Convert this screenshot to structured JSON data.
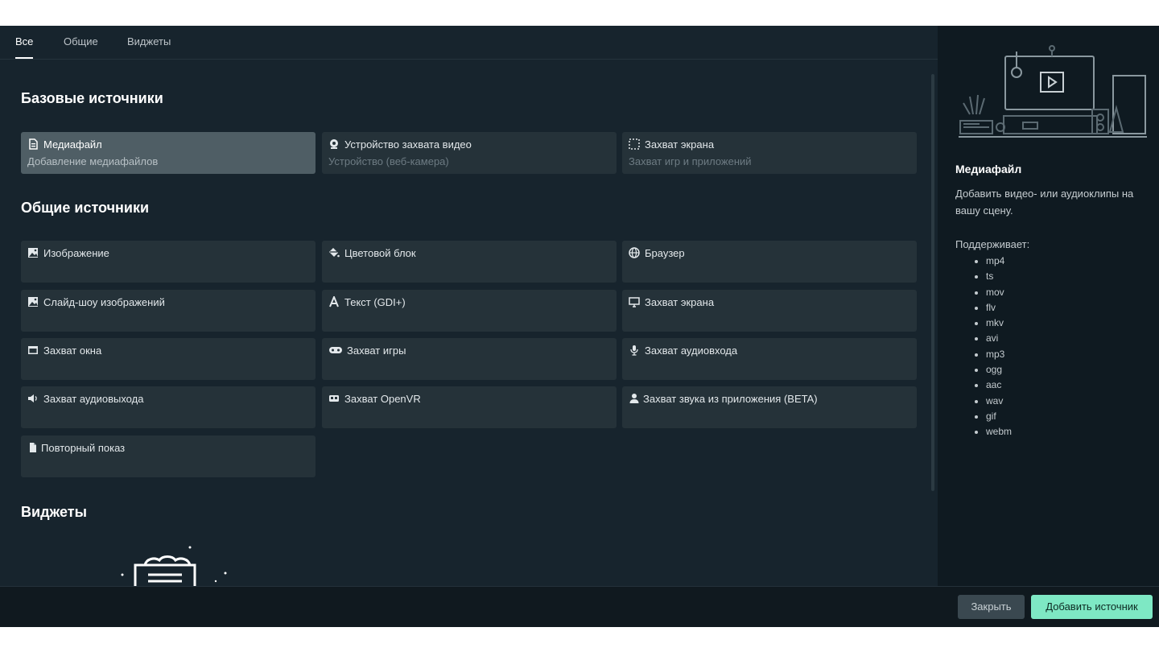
{
  "tabs": [
    {
      "label": "Все",
      "active": true
    },
    {
      "label": "Общие",
      "active": false
    },
    {
      "label": "Виджеты",
      "active": false
    }
  ],
  "sections": {
    "basic": "Базовые источники",
    "general": "Общие источники",
    "widgets": "Виджеты"
  },
  "basic_sources": [
    {
      "name": "Медиафайл",
      "desc": "Добавление медиафайлов",
      "icon": "file-icon",
      "selected": true
    },
    {
      "name": "Устройство захвата видео",
      "desc": "Устройство (веб-камера)",
      "icon": "webcam-icon"
    },
    {
      "name": "Захват экрана",
      "desc": "Захват игр и приложений",
      "icon": "screen-region-icon"
    }
  ],
  "general_sources": [
    {
      "name": "Изображение",
      "icon": "image-icon"
    },
    {
      "name": "Цветовой блок",
      "icon": "paint-bucket-icon"
    },
    {
      "name": "Браузер",
      "icon": "globe-icon"
    },
    {
      "name": "Слайд-шоу изображений",
      "icon": "image-icon"
    },
    {
      "name": "Текст (GDI+)",
      "icon": "text-icon"
    },
    {
      "name": "Захват экрана",
      "icon": "monitor-icon"
    },
    {
      "name": "Захват окна",
      "icon": "window-icon"
    },
    {
      "name": "Захват игры",
      "icon": "gamepad-icon"
    },
    {
      "name": "Захват аудиовхода",
      "icon": "microphone-icon"
    },
    {
      "name": "Захват аудиовыхода",
      "icon": "speaker-icon"
    },
    {
      "name": "Захват OpenVR",
      "icon": "vr-headset-icon"
    },
    {
      "name": "Захват звука из приложения (BETA)",
      "icon": "user-icon"
    },
    {
      "name": "Повторный показ",
      "icon": "document-icon"
    }
  ],
  "details": {
    "title": "Медиафайл",
    "description": "Добавить видео- или аудиоклипы на вашу сцену.",
    "supports_label": "Поддерживает:",
    "formats": [
      "mp4",
      "ts",
      "mov",
      "flv",
      "mkv",
      "avi",
      "mp3",
      "ogg",
      "aac",
      "wav",
      "gif",
      "webm"
    ]
  },
  "footer": {
    "close_label": "Закрыть",
    "add_label": "Добавить источник"
  },
  "colors": {
    "background": "#17242d",
    "card": "#253239",
    "card_selected": "#4f5e65",
    "accent": "#7ee8c4"
  }
}
